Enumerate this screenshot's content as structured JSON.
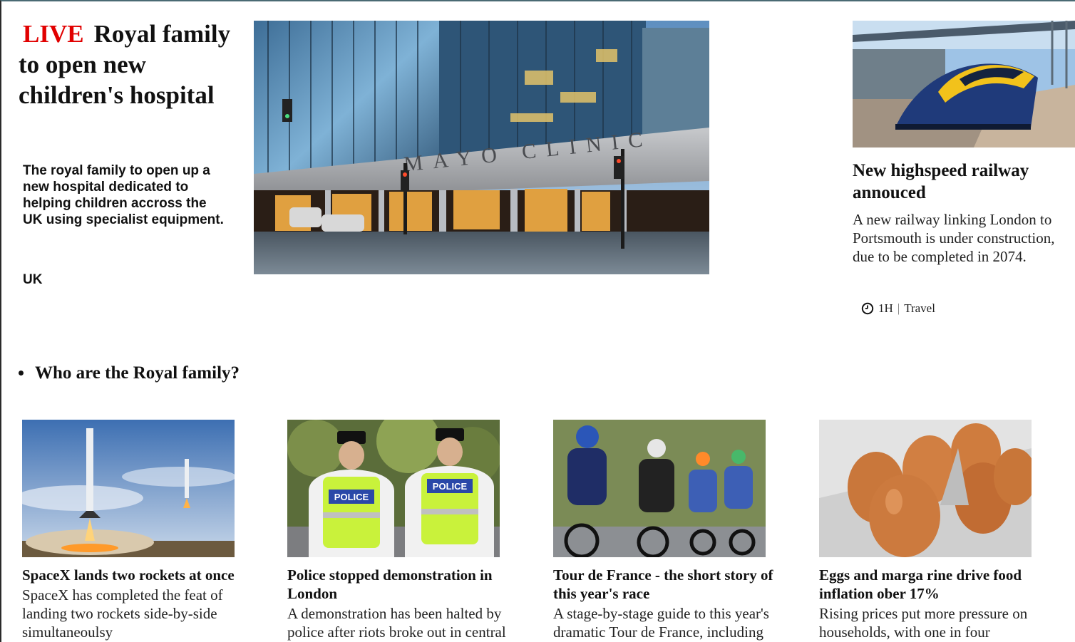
{
  "lead": {
    "live_label": "LIVE",
    "title_part1": "Royal family",
    "title_part2": "to open new children's hospital",
    "summary": "The royal family to open up a new hospital dedicated to helping children accross the UK using specialist equipment.",
    "tag": "UK",
    "image_sign_text": "MAYO  CLINIC"
  },
  "side_story": {
    "title": "New highspeed railway annouced",
    "description": "A new railway linking London to Portsmouth is under construction, due to be completed in 2074.",
    "time": "1H",
    "separator": "|",
    "category": "Travel",
    "icon": "clock-icon"
  },
  "bullets": [
    {
      "label": "Who are the Royal family?"
    }
  ],
  "cards": [
    {
      "title": "SpaceX lands two rockets at once",
      "description": "SpaceX has completed the feat of landing two rockets side-by-side simultaneoulsy"
    },
    {
      "title": "Police stopped demonstration in London",
      "description": "A demonstration has been halted by police after riots broke out in central",
      "vest_text": "POLICE"
    },
    {
      "title": "Tour de France - the short story of this year's race",
      "description": "A stage-by-stage guide to this year's dramatic Tour de France, including"
    },
    {
      "title": "Eggs and marga rine drive food inflation ober 17%",
      "description": "Rising prices put more pressure on households, with one in four"
    }
  ],
  "colors": {
    "live": "#e10000",
    "text": "#111111"
  }
}
